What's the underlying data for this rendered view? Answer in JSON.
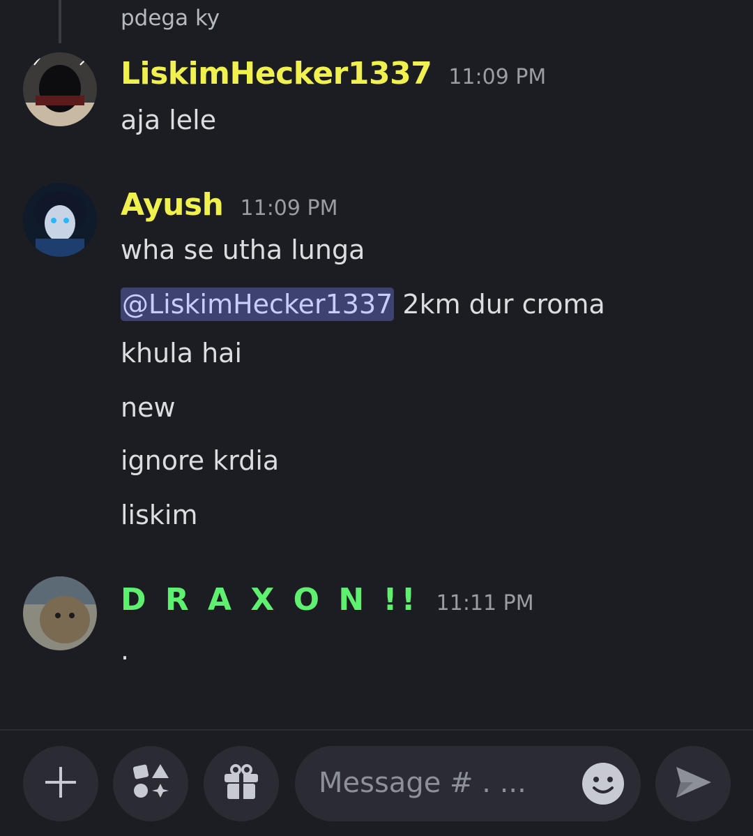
{
  "reply": {
    "text": "pdega ky"
  },
  "messages": [
    {
      "username": "LiskimHecker1337",
      "username_color": "#f0f04e",
      "timestamp": "11:09 PM",
      "lines": [
        "aja lele"
      ]
    },
    {
      "username": "Ayush",
      "username_color": "#f0f04e",
      "timestamp": "11:09 PM",
      "lines": [
        "wha se utha lunga",
        "2km dur croma",
        "khula hai",
        "new",
        "ignore krdia",
        "liskim"
      ],
      "mention": "@LiskimHecker1337"
    },
    {
      "username": "D R A X O N  !!",
      "username_color": "#5ff06f",
      "timestamp": "11:11 PM",
      "lines": [
        "."
      ]
    }
  ],
  "composer": {
    "placeholder": "Message # . ...",
    "icons": [
      "plus-icon",
      "apps-icon",
      "gift-icon",
      "emoji-icon",
      "send-icon"
    ]
  },
  "colors": {
    "background": "#1c1d22",
    "button": "#2b2c33",
    "mention_bg": "#3d4270"
  }
}
